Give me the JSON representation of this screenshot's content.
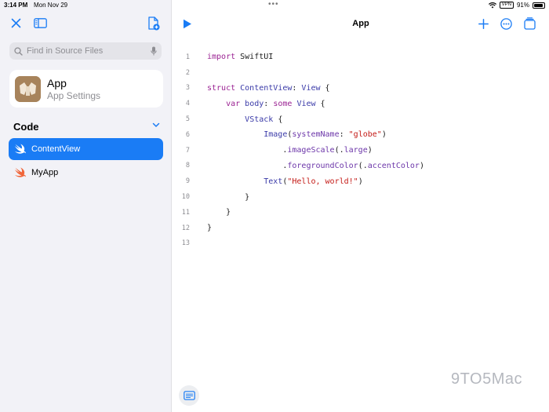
{
  "status_bar": {
    "time": "3:14 PM",
    "date": "Mon Nov 29",
    "vpn": "VPN",
    "battery": "91%",
    "battery_fraction": 0.91
  },
  "sidebar": {
    "search_placeholder": "Find in Source Files",
    "app_card": {
      "name": "App",
      "subtitle": "App Settings"
    },
    "section_title": "Code",
    "files": [
      {
        "label": "ContentView",
        "active": true
      },
      {
        "label": "MyApp",
        "active": false
      }
    ]
  },
  "editor": {
    "title": "App",
    "watermark": "9TO5Mac",
    "line_numbers": [
      "1",
      "2",
      "3",
      "4",
      "5",
      "6",
      "7",
      "8",
      "9",
      "10",
      "11",
      "12",
      "13"
    ],
    "code": {
      "l1": {
        "kw": "import",
        "rest": " SwiftUI"
      },
      "l3": {
        "kw": "struct",
        "name": " ContentView",
        "colon": ": ",
        "proto": "View",
        "brace": " {"
      },
      "l4": {
        "kw1": "var",
        "name": " body",
        "colon": ": ",
        "kw2": "some",
        "sp": " ",
        "type": "View",
        "brace": " {"
      },
      "l5": {
        "type": "VStack",
        "brace": " {"
      },
      "l6": {
        "type": "Image",
        "open": "(",
        "arg": "systemName",
        "colon": ": ",
        "str": "\"globe\"",
        "close": ")"
      },
      "l7": {
        "dot": ".",
        "fn": "imageScale",
        "open": "(.",
        "arg": "large",
        "close": ")"
      },
      "l8": {
        "dot": ".",
        "fn": "foregroundColor",
        "open": "(.",
        "arg": "accentColor",
        "close": ")"
      },
      "l9": {
        "type": "Text",
        "open": "(",
        "str": "\"Hello, world!\"",
        "close": ")"
      },
      "l10": {
        "brace": "}"
      },
      "l11": {
        "brace": "}"
      },
      "l12": {
        "brace": "}"
      }
    }
  },
  "icons": {
    "close": "close-icon",
    "sidebar_toggle": "sidebar-toggle-icon",
    "new_file": "new-file-icon",
    "search": "search-icon",
    "mic": "mic-icon",
    "chevron": "chevron-down-icon",
    "swift": "swift-icon",
    "run": "play-icon",
    "add": "plus-icon",
    "more": "ellipsis-circle-icon",
    "windows": "windows-stack-icon",
    "console": "console-icon"
  },
  "colors": {
    "accent": "#1a7cf5",
    "sidebar_bg": "#f2f2f7",
    "swift": "#f0663a"
  }
}
